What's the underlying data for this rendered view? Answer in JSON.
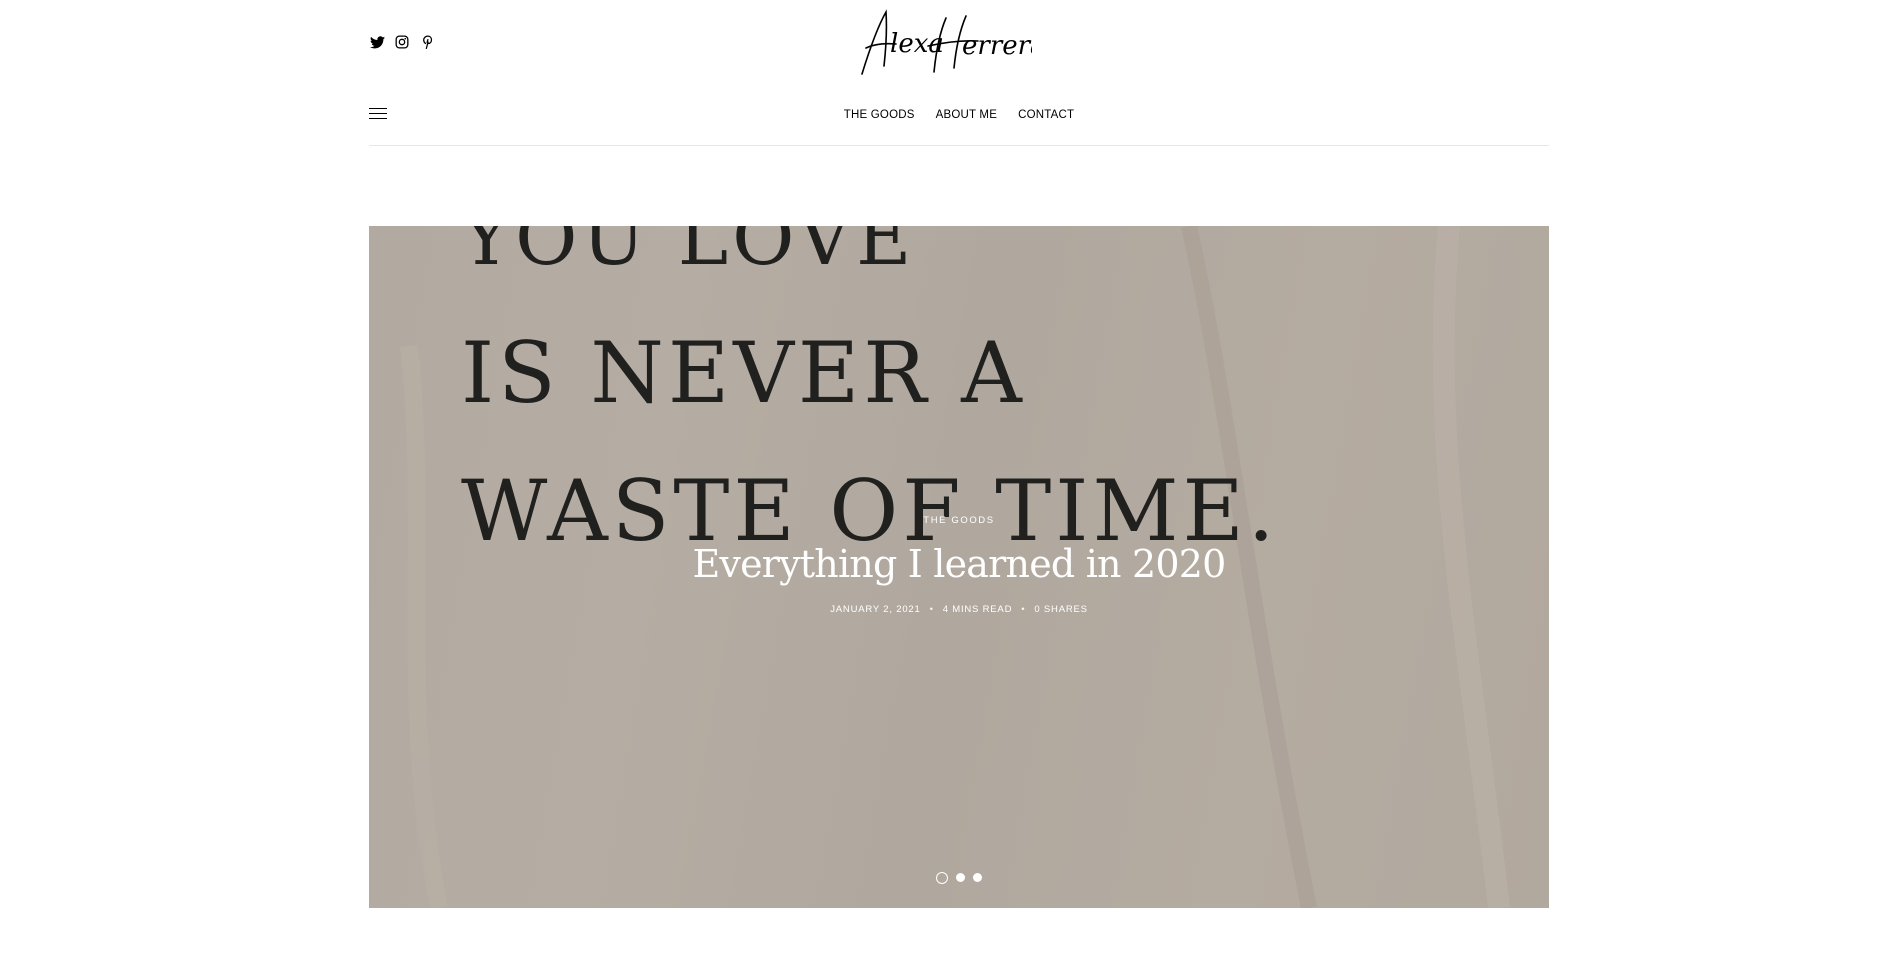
{
  "site": {
    "logo_text": "Alexa Herrera",
    "social": [
      {
        "icon": "twitter-icon"
      },
      {
        "icon": "instagram-icon"
      },
      {
        "icon": "pinterest-icon"
      }
    ]
  },
  "nav": {
    "items": [
      {
        "label": "THE GOODS"
      },
      {
        "label": "ABOUT ME"
      },
      {
        "label": "CONTACT"
      }
    ]
  },
  "hero": {
    "image_text": [
      "YOU LOVE",
      "IS NEVER A",
      "WASTE OF TIME."
    ],
    "category": "THE GOODS",
    "title": "Everything I learned in 2020",
    "date": "JANUARY 2, 2021",
    "read_time": "4 MINS READ",
    "shares": "0 SHARES",
    "slide_count": 3,
    "active_slide": 1
  },
  "colors": {
    "hero_background": "#b8aea6",
    "text_on_image": "#1a1a1a",
    "divider": "#e6e6e6"
  }
}
